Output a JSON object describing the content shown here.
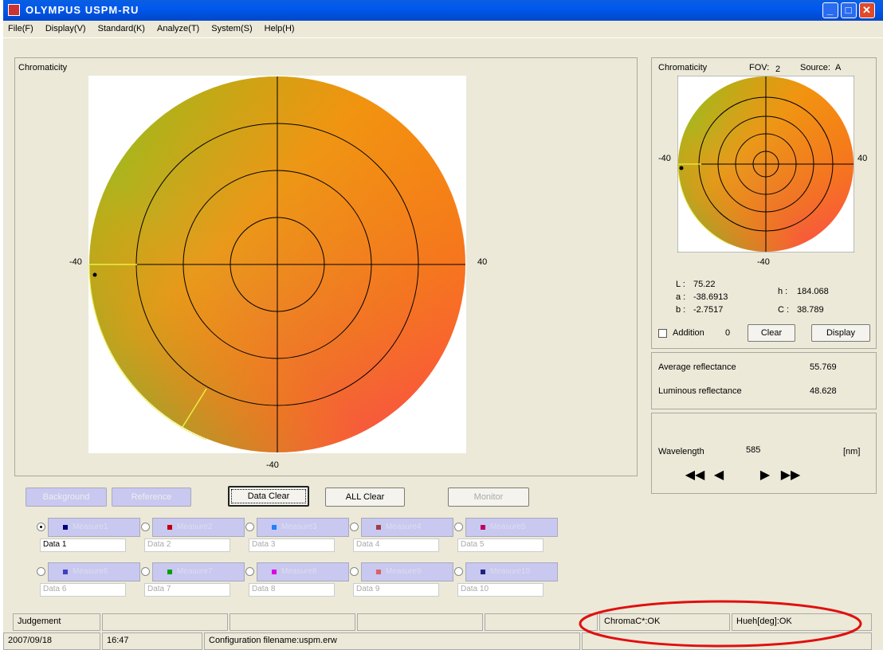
{
  "window": {
    "title": "OLYMPUS USPM-RU"
  },
  "menu": [
    "File(F)",
    "Display(V)",
    "Standard(K)",
    "Analyze(T)",
    "System(S)",
    "Help(H)"
  ],
  "main_chart": {
    "label": "Chromaticity",
    "tick_left": "-40",
    "tick_right": "40",
    "tick_bottom": "-40"
  },
  "side_chart": {
    "label": "Chromaticity",
    "fov_label": "FOV:",
    "fov_value": "2",
    "source_label": "Source:",
    "source_value": "A",
    "tick_left": "-40",
    "tick_right": "40",
    "tick_bottom": "-40"
  },
  "values": {
    "L_label": "L :",
    "L": "75.22",
    "a_label": "a :",
    "a": "-38.6913",
    "b_label": "b :",
    "b": "-2.7517",
    "h_label": "h :",
    "h": "184.068",
    "C_label": "C :",
    "C": "38.789"
  },
  "addition": {
    "label": "Addition",
    "count": "0",
    "checked": false
  },
  "buttons": {
    "clear": "Clear",
    "display": "Display",
    "background": "Background",
    "reference": "Reference",
    "data_clear": "Data Clear",
    "all_clear": "ALL Clear",
    "monitor": "Monitor"
  },
  "reflectance": {
    "avg_label": "Average reflectance",
    "avg": "55.769",
    "lum_label": "Luminous reflectance",
    "lum": "48.628"
  },
  "wavelength": {
    "label": "Wavelength",
    "value": "585",
    "unit": "[nm]"
  },
  "measures": [
    {
      "label": "Measure1",
      "data": "Data 1",
      "color": "#000080",
      "selected": true
    },
    {
      "label": "Measure2",
      "data": "Data 2",
      "color": "#c00000",
      "selected": false
    },
    {
      "label": "Measure3",
      "data": "Data 3",
      "color": "#2080ff",
      "selected": false
    },
    {
      "label": "Measure4",
      "data": "Data 4",
      "color": "#a04040",
      "selected": false
    },
    {
      "label": "Measure5",
      "data": "Data 5",
      "color": "#c00060",
      "selected": false
    },
    {
      "label": "Measure6",
      "data": "Data 6",
      "color": "#4040c0",
      "selected": false
    },
    {
      "label": "Measure7",
      "data": "Data 7",
      "color": "#00a000",
      "selected": false
    },
    {
      "label": "Measure8",
      "data": "Data 8",
      "color": "#e000e0",
      "selected": false
    },
    {
      "label": "Measure9",
      "data": "Data 9",
      "color": "#e06060",
      "selected": false
    },
    {
      "label": "Measure10",
      "data": "Data 10",
      "color": "#202080",
      "selected": false
    }
  ],
  "status": {
    "judgement": "Judgement",
    "chroma": "ChromaC*:OK",
    "hue": "Hueh[deg]:OK",
    "date": "2007/09/18",
    "time": "16:47",
    "config": "Configuration filename:uspm.erw"
  }
}
